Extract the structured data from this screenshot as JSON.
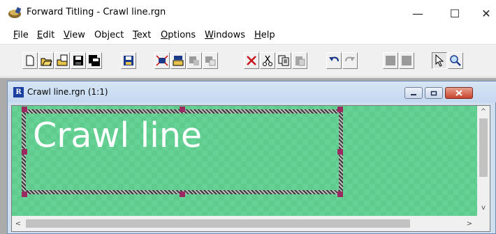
{
  "app": {
    "title": "Forward Titling - Crawl line.rgn",
    "icon": "forward-titling-app-icon",
    "min_glyph": "—",
    "max_glyph": "☐",
    "close_glyph": "✕"
  },
  "menu": {
    "items": [
      {
        "key": "F",
        "rest": "ile"
      },
      {
        "key": "E",
        "rest": "dit"
      },
      {
        "key": "V",
        "rest": "iew"
      },
      {
        "key": "",
        "rest": "Object"
      },
      {
        "key": "T",
        "rest": "ext"
      },
      {
        "key": "O",
        "rest": "ptions"
      },
      {
        "key": "W",
        "rest": "indows"
      },
      {
        "key": "H",
        "rest": "elp"
      }
    ]
  },
  "toolbar": {
    "buttons": [
      "new-icon",
      "open-icon",
      "open-template-icon",
      "save-icon",
      "save-as-icon",
      "save-disk-icon",
      "import-icon",
      "export-icon",
      "grid-disabled-icon",
      "grid-alt-disabled-icon",
      "delete-icon",
      "cut-icon",
      "copy-icon",
      "paste-disabled-icon",
      "undo-icon",
      "redo-disabled-icon",
      "layer-disabled-icon",
      "layer-alt-disabled-icon",
      "pointer-icon",
      "zoom-icon"
    ]
  },
  "child_window": {
    "title": "Crawl line.rgn  (1:1)",
    "icon_letter": "R",
    "canvas_text": "Crawl line",
    "colors": {
      "canvas_green": "#67d295",
      "handle": "#9b2a62",
      "text": "#ffffff"
    },
    "scroll": {
      "up_glyph": "^",
      "down_glyph": "v",
      "left_glyph": "<",
      "right_glyph": ">"
    }
  }
}
